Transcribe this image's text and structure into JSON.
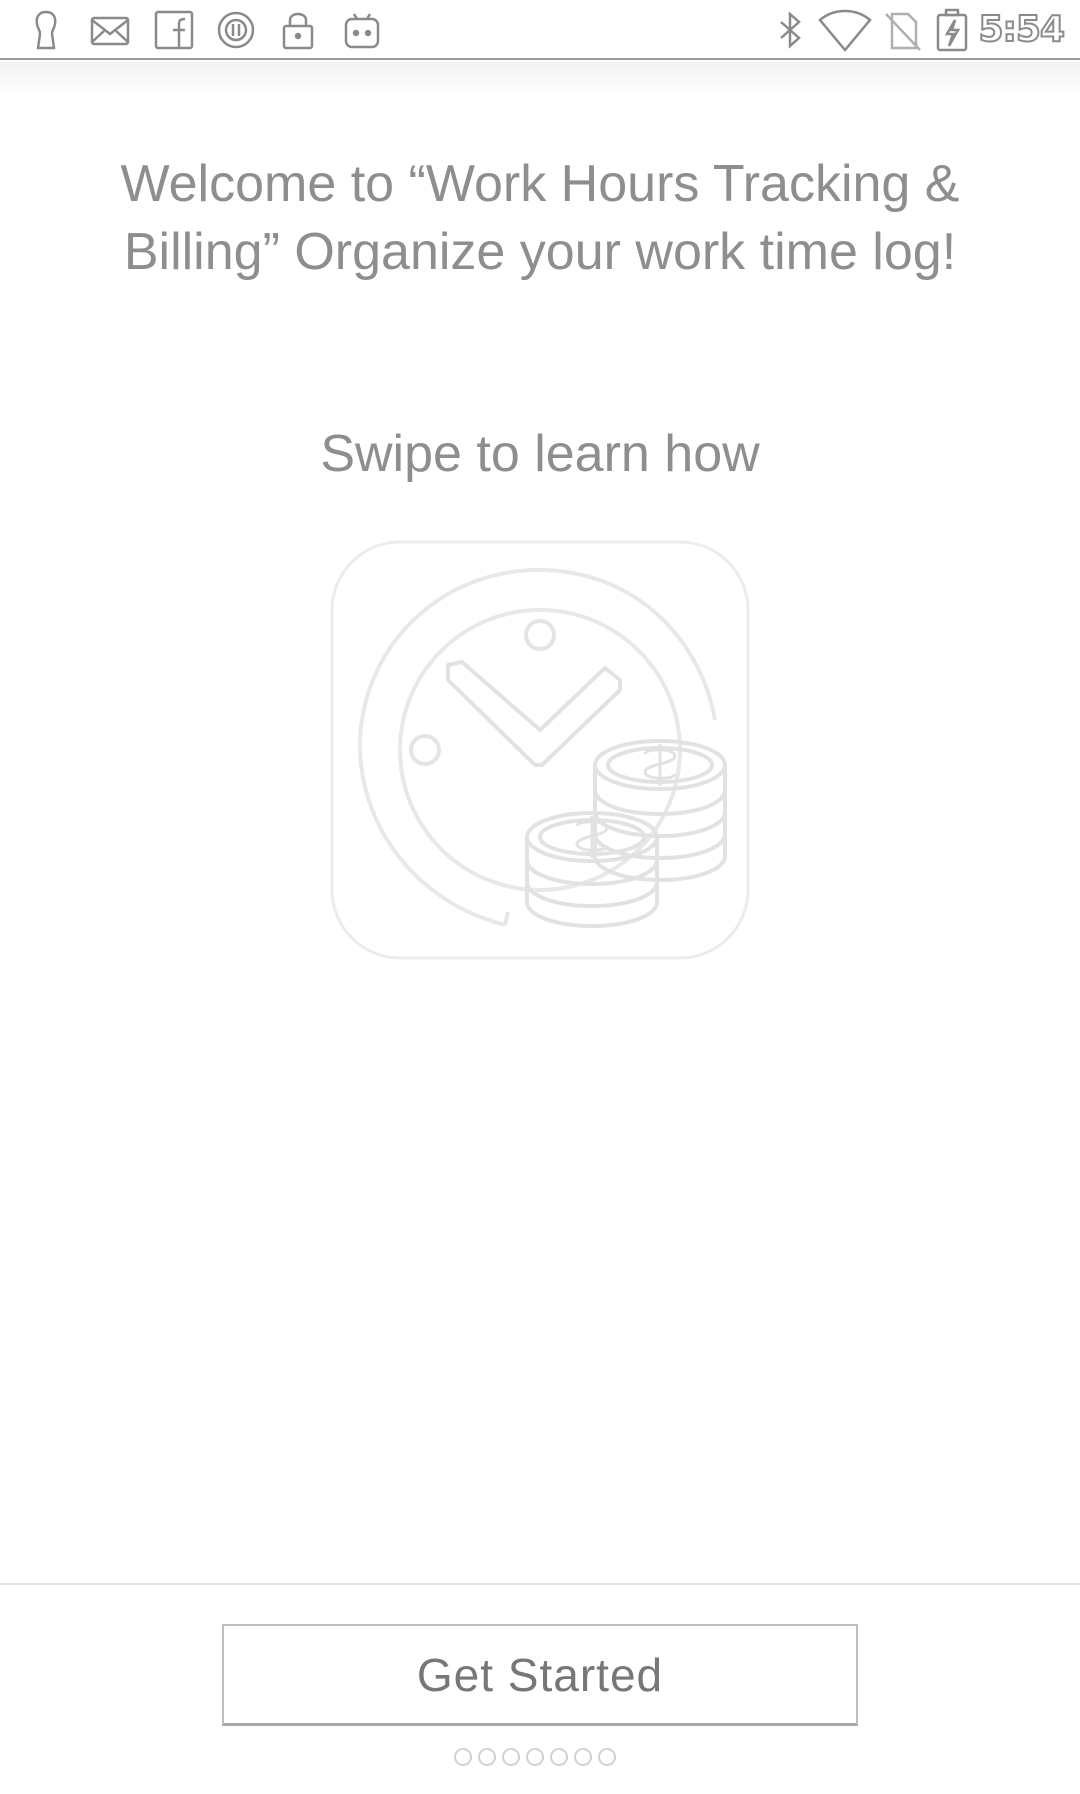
{
  "status_bar": {
    "time": "5:54",
    "left_icons": [
      "keyhole-icon",
      "mail-icon",
      "facebook-icon",
      "circle-pause-icon",
      "lock-icon",
      "android-icon"
    ],
    "right_icons": [
      "bluetooth-icon",
      "wifi-icon",
      "no-sim-icon",
      "battery-charging-icon"
    ]
  },
  "onboarding": {
    "welcome_text": "Welcome to “Work Hours Tracking & Billing” Organize your work time log!",
    "swipe_hint": "Swipe to learn how",
    "illustration_icon": "clock-coins-icon"
  },
  "footer": {
    "get_started_label": "Get Started",
    "page_count": 7,
    "current_page": 1
  },
  "colors": {
    "text": "#8e8e8e",
    "button_text": "#777777",
    "illustration_stroke": "#e6e6e6"
  }
}
